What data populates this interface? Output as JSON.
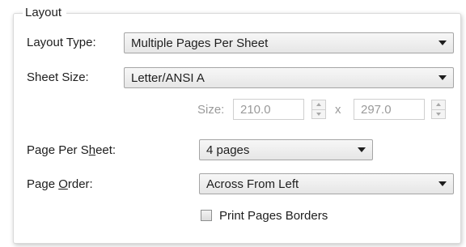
{
  "group": {
    "title": "Layout"
  },
  "layout_type": {
    "label": "Layout Type:",
    "value": "Multiple Pages Per Sheet"
  },
  "sheet_size": {
    "label": "Sheet Size:",
    "value": "Letter/ANSI A"
  },
  "size": {
    "label": "Size:",
    "width": "210.0",
    "separator": "x",
    "height": "297.0"
  },
  "pages_per_sheet": {
    "label_pre": "Page Per S",
    "label_key": "h",
    "label_post": "eet:",
    "value": "4 pages"
  },
  "page_order": {
    "label_pre": "Page ",
    "label_key": "O",
    "label_post": "rder:",
    "value": "Across From Left"
  },
  "print_borders": {
    "label": "Print Pages Borders",
    "checked": false
  },
  "icons": {
    "dropdown": "chevron-down-icon",
    "spin_up": "spin-up-icon",
    "spin_down": "spin-down-icon"
  },
  "colors": {
    "disabled_text": "#9a9a9a",
    "panel_border": "#d9d9d9"
  }
}
